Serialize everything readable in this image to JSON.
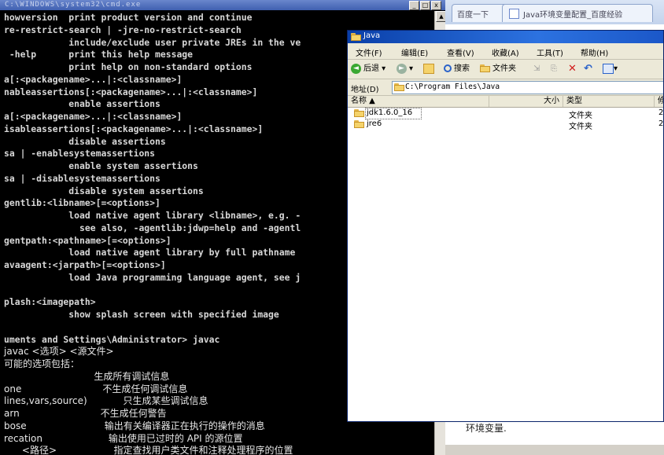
{
  "console": {
    "title": "C:\\WINDOWS\\system32\\cmd.exe",
    "controls": [
      "_",
      "□",
      "x"
    ],
    "lines": [
      {
        "text": "howversion  print product version and continue",
        "cjk": false
      },
      {
        "text": "re-restrict-search | -jre-no-restrict-search",
        "cjk": false
      },
      {
        "text": "            include/exclude user private JREs in the ve",
        "cjk": false
      },
      {
        "text": " -help      print this help message",
        "cjk": false
      },
      {
        "text": "            print help on non-standard options",
        "cjk": false
      },
      {
        "text": "a[:<packagename>...|:<classname>]",
        "cjk": false
      },
      {
        "text": "nableassertions[:<packagename>...|:<classname>]",
        "cjk": false
      },
      {
        "text": "            enable assertions",
        "cjk": false
      },
      {
        "text": "a[:<packagename>...|:<classname>]",
        "cjk": false
      },
      {
        "text": "isableassertions[:<packagename>...|:<classname>]",
        "cjk": false
      },
      {
        "text": "            disable assertions",
        "cjk": false
      },
      {
        "text": "sa | -enablesystemassertions",
        "cjk": false
      },
      {
        "text": "            enable system assertions",
        "cjk": false
      },
      {
        "text": "sa | -disablesystemassertions",
        "cjk": false
      },
      {
        "text": "            disable system assertions",
        "cjk": false
      },
      {
        "text": "gentlib:<libname>[=<options>]",
        "cjk": false
      },
      {
        "text": "            load native agent library <libname>, e.g. -",
        "cjk": false
      },
      {
        "text": "              see also, -agentlib:jdwp=help and -agentl",
        "cjk": false
      },
      {
        "text": "gentpath:<pathname>[=<options>]",
        "cjk": false
      },
      {
        "text": "            load native agent library by full pathname",
        "cjk": false
      },
      {
        "text": "avaagent:<jarpath>[=<options>]",
        "cjk": false
      },
      {
        "text": "            load Java programming language agent, see j",
        "cjk": false
      },
      {
        "text": "",
        "cjk": false
      },
      {
        "text": "plash:<imagepath>",
        "cjk": false
      },
      {
        "text": "            show splash screen with specified image",
        "cjk": false
      },
      {
        "text": "",
        "cjk": false
      },
      {
        "text": "uments and Settings\\Administrator> javac",
        "cjk": false
      },
      {
        "text": "javac <选项> <源文件>",
        "cjk": true
      },
      {
        "text": "可能的选项包括：",
        "cjk": true
      },
      {
        "text": "                              生成所有调试信息",
        "cjk": true
      },
      {
        "text": "one                           不生成任何调试信息",
        "cjk": true
      },
      {
        "text": "lines,vars,source)            只生成某些调试信息",
        "cjk": true
      },
      {
        "text": "arn                           不生成任何警告",
        "cjk": true
      },
      {
        "text": "bose                          输出有关编译器正在执行的操作的消息",
        "cjk": true
      },
      {
        "text": "recation                      输出使用已过时的 API 的源位置",
        "cjk": true
      },
      {
        "text": "      <路径>                   指定查找用户类文件和注释处理程序的位置",
        "cjk": true
      }
    ]
  },
  "browser": {
    "tabs": [
      "百度一下",
      "Java环境变量配置_百度经验"
    ],
    "behind_text": "环境变量."
  },
  "explorer": {
    "title": "Java",
    "menu": [
      "文件(F)",
      "编辑(E)",
      "查看(V)",
      "收藏(A)",
      "工具(T)",
      "帮助(H)"
    ],
    "toolbar": {
      "back": "后退",
      "search": "搜索",
      "folders": "文件夹"
    },
    "address_label": "地址(D)",
    "address": "C:\\Program Files\\Java",
    "columns": [
      "名称 ▲",
      "大小",
      "类型",
      "修"
    ],
    "files": [
      {
        "name": "jdk1.6.0_16",
        "type": "文件夹",
        "extra": "2"
      },
      {
        "name": "jre6",
        "type": "文件夹",
        "extra": "2"
      }
    ]
  }
}
